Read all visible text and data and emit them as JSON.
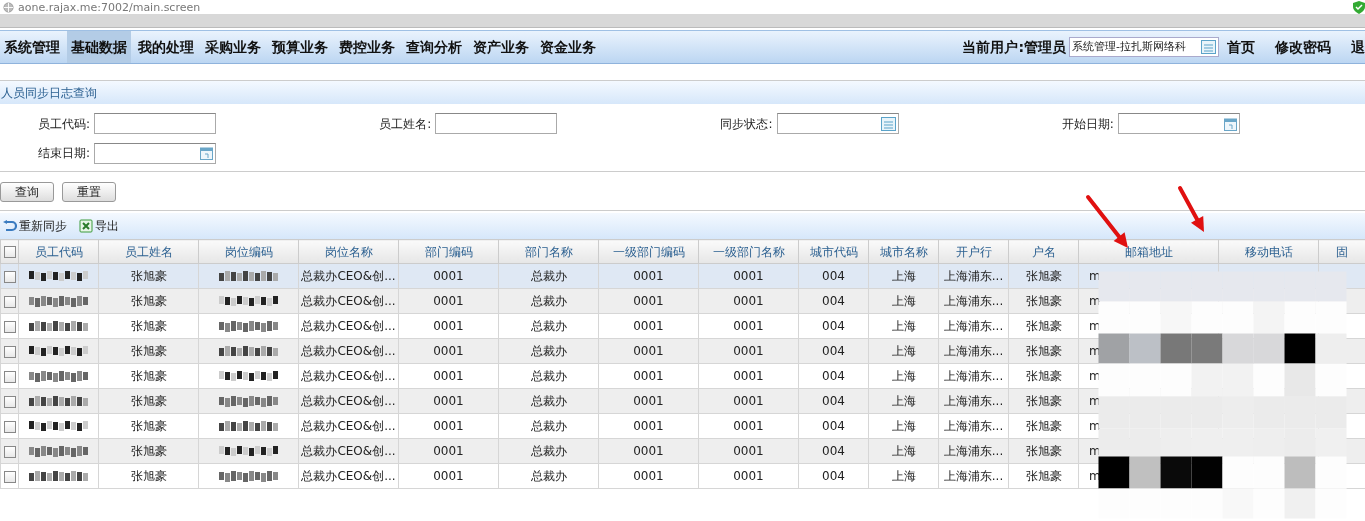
{
  "address_bar": {
    "url": "aone.rajax.me:7002/main.screen"
  },
  "nav": {
    "items": [
      {
        "label": "系统管理",
        "selected": false
      },
      {
        "label": "基础数据",
        "selected": true
      },
      {
        "label": "我的处理",
        "selected": false
      },
      {
        "label": "采购业务",
        "selected": false
      },
      {
        "label": "预算业务",
        "selected": false
      },
      {
        "label": "费控业务",
        "selected": false
      },
      {
        "label": "查询分析",
        "selected": false
      },
      {
        "label": "资产业务",
        "selected": false
      },
      {
        "label": "资金业务",
        "selected": false
      }
    ],
    "current_user": "当前用户:管理员",
    "org_select": "系统管理-拉扎斯网络科",
    "links": [
      "首页",
      "修改密码",
      "退"
    ]
  },
  "panel": {
    "title": "人员同步日志查询"
  },
  "filters": [
    {
      "label": "员工代码:",
      "kind": "text"
    },
    {
      "label": "员工姓名:",
      "kind": "text"
    },
    {
      "label": "同步状态:",
      "kind": "select"
    },
    {
      "label": "开始日期:",
      "kind": "date"
    },
    {
      "label": "结束日期:",
      "kind": "date"
    }
  ],
  "buttons": [
    "查询",
    "重置"
  ],
  "toolbar": [
    {
      "label": "重新同步",
      "kind": "resync"
    },
    {
      "label": "导出",
      "kind": "export"
    }
  ],
  "table": {
    "select_all": {
      "checked": false
    },
    "columns": [
      {
        "title": "员工代码",
        "kind": "redacted"
      },
      {
        "title": "员工姓名",
        "kind": "text"
      },
      {
        "title": "岗位编码",
        "kind": "redacted"
      },
      {
        "title": "岗位名称",
        "kind": "text"
      },
      {
        "title": "部门编码",
        "kind": "text"
      },
      {
        "title": "部门名称",
        "kind": "text"
      },
      {
        "title": "一级部门编码",
        "kind": "text"
      },
      {
        "title": "一级部门名称",
        "kind": "text"
      },
      {
        "title": "城市代码",
        "kind": "text"
      },
      {
        "title": "城市名称",
        "kind": "text"
      },
      {
        "title": "开户行",
        "kind": "text"
      },
      {
        "title": "户名",
        "kind": "text"
      },
      {
        "title": "邮箱地址",
        "kind": "text"
      },
      {
        "title": "移动电话",
        "kind": "blank"
      },
      {
        "title": "固",
        "kind": "blank"
      }
    ],
    "rows": [
      {
        "selected": true,
        "checked": false,
        "cells": [
          "",
          "张旭豪",
          "",
          "总裁办CEO&创...",
          "0001",
          "总裁办",
          "0001",
          "0001",
          "004",
          "上海",
          "上海浦东...",
          "张旭豪",
          "m",
          "",
          ""
        ]
      },
      {
        "selected": false,
        "checked": false,
        "cells": [
          "",
          "张旭豪",
          "",
          "总裁办CEO&创...",
          "0001",
          "总裁办",
          "0001",
          "0001",
          "004",
          "上海",
          "上海浦东...",
          "张旭豪",
          "m",
          "",
          ""
        ]
      },
      {
        "selected": false,
        "checked": false,
        "cells": [
          "",
          "张旭豪",
          "",
          "总裁办CEO&创...",
          "0001",
          "总裁办",
          "0001",
          "0001",
          "004",
          "上海",
          "上海浦东...",
          "张旭豪",
          "m",
          "",
          ""
        ]
      },
      {
        "selected": false,
        "checked": false,
        "cells": [
          "",
          "张旭豪",
          "",
          "总裁办CEO&创...",
          "0001",
          "总裁办",
          "0001",
          "0001",
          "004",
          "上海",
          "上海浦东...",
          "张旭豪",
          "m",
          "",
          ""
        ]
      },
      {
        "selected": false,
        "checked": false,
        "cells": [
          "",
          "张旭豪",
          "",
          "总裁办CEO&创...",
          "0001",
          "总裁办",
          "0001",
          "0001",
          "004",
          "上海",
          "上海浦东...",
          "张旭豪",
          "m",
          "",
          ""
        ]
      },
      {
        "selected": false,
        "checked": false,
        "cells": [
          "",
          "张旭豪",
          "",
          "总裁办CEO&创...",
          "0001",
          "总裁办",
          "0001",
          "0001",
          "004",
          "上海",
          "上海浦东...",
          "张旭豪",
          "m",
          "",
          ""
        ]
      },
      {
        "selected": false,
        "checked": false,
        "cells": [
          "",
          "张旭豪",
          "",
          "总裁办CEO&创...",
          "0001",
          "总裁办",
          "0001",
          "0001",
          "004",
          "上海",
          "上海浦东...",
          "张旭豪",
          "m",
          "",
          ""
        ]
      },
      {
        "selected": false,
        "checked": false,
        "cells": [
          "",
          "张旭豪",
          "",
          "总裁办CEO&创...",
          "0001",
          "总裁办",
          "0001",
          "0001",
          "004",
          "上海",
          "上海浦东...",
          "张旭豪",
          "m",
          "",
          ""
        ]
      },
      {
        "selected": false,
        "checked": false,
        "cells": [
          "",
          "张旭豪",
          "",
          "总裁办CEO&创...",
          "0001",
          "总裁办",
          "0001",
          "0001",
          "004",
          "上海",
          "上海浦东...",
          "张旭豪",
          "m",
          "",
          ""
        ]
      }
    ]
  }
}
